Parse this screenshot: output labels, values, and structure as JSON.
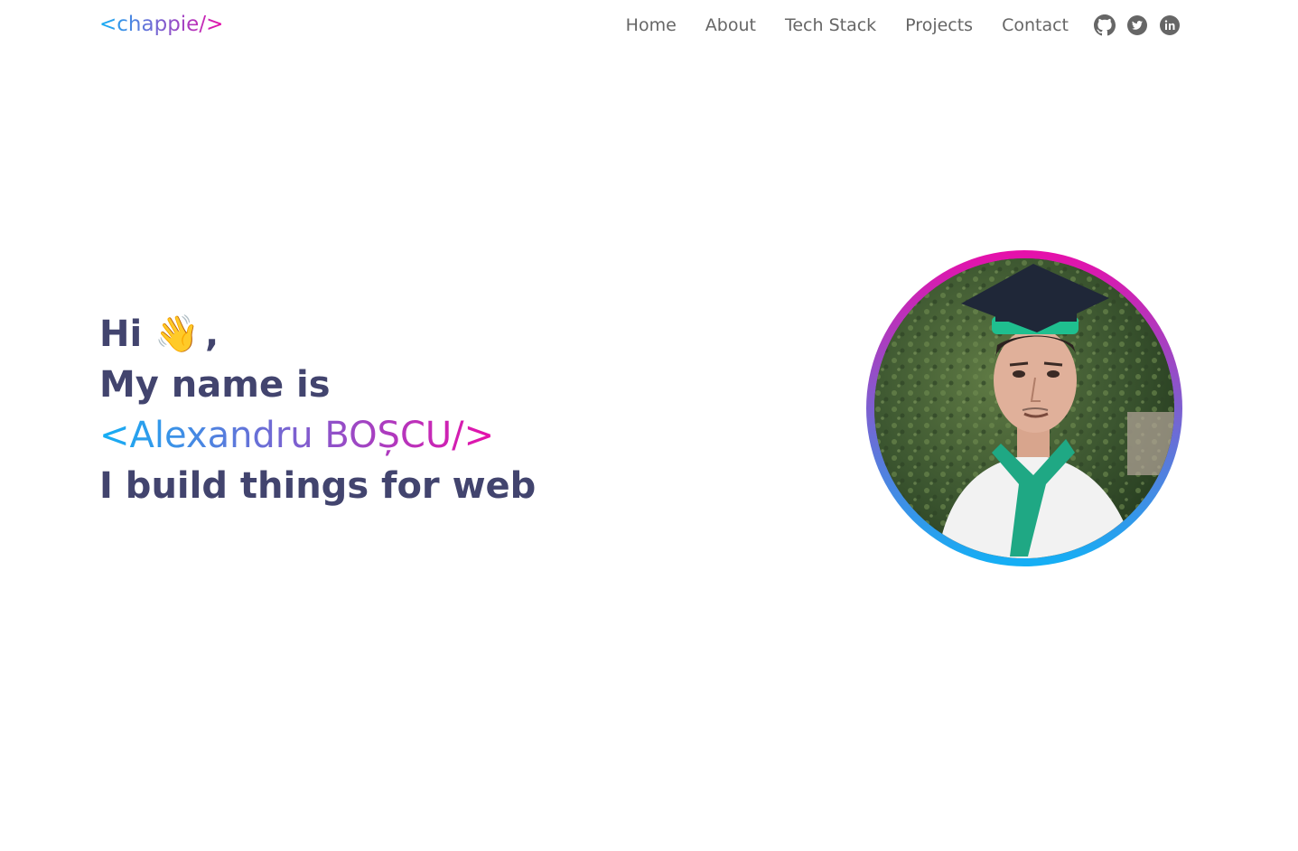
{
  "header": {
    "logo": "<chappie/>",
    "nav": [
      "Home",
      "About",
      "Tech Stack",
      "Projects",
      "Contact"
    ],
    "social_icons": [
      "github-icon",
      "twitter-icon",
      "linkedin-icon"
    ]
  },
  "hero": {
    "greeting": "Hi",
    "wave_emoji": "👋",
    "greeting_suffix": ",",
    "line2": "My name is",
    "name": "<Alexandru BOȘCU/>",
    "line4": "I build things for web"
  },
  "colors": {
    "gradient_start": "#13b0f5",
    "gradient_end": "#e70faa",
    "heading": "#42446e",
    "nav": "#666666"
  }
}
